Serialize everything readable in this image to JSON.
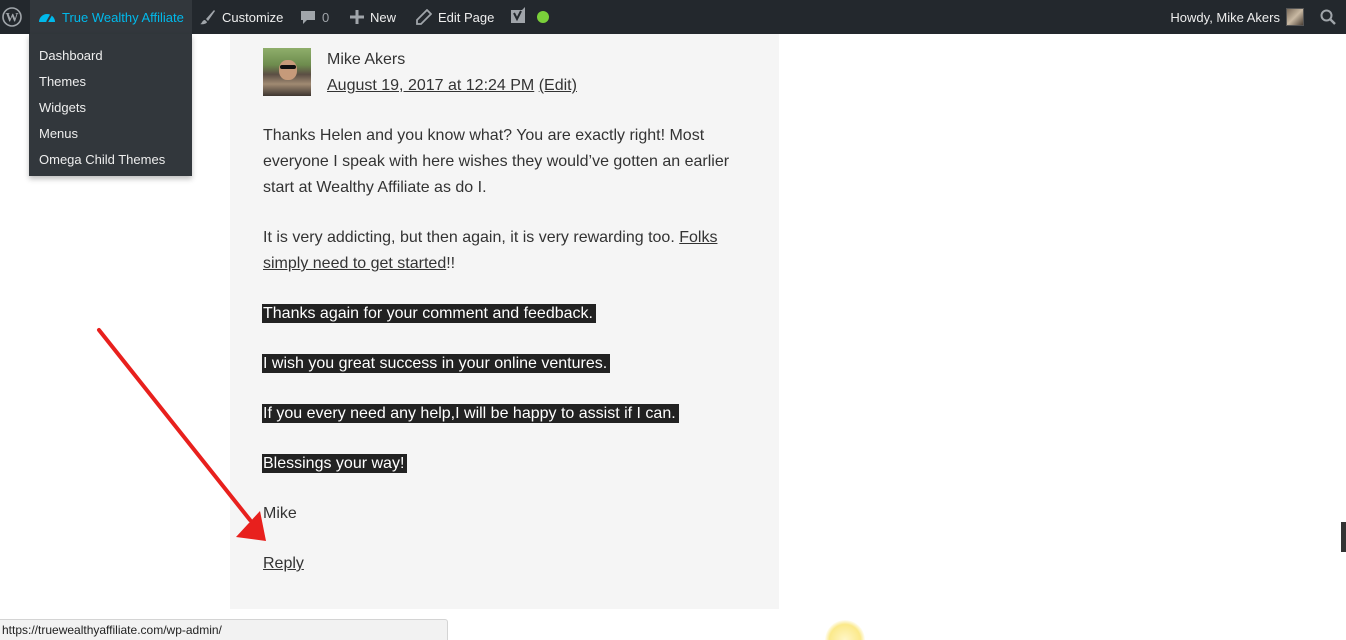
{
  "adminbar": {
    "site_name": "True Wealthy Affiliate",
    "customize": "Customize",
    "comments_count": "0",
    "new": "New",
    "edit_page": "Edit Page",
    "howdy": "Howdy, Mike Akers",
    "yoast_status_color": "#7ad03a",
    "accent_color": "#00b9eb"
  },
  "dropdown": {
    "items": [
      "Dashboard",
      "Themes",
      "Widgets",
      "Menus",
      "Omega Child Themes"
    ]
  },
  "comment": {
    "author": "Mike Akers",
    "date": "August 19, 2017 at 12:24 PM",
    "edit": "(Edit)",
    "para1": "Thanks Helen and you know what? You are exactly right! Most everyone I speak with here wishes they would’ve gotten an earlier start at Wealthy Affiliate as do I.",
    "para2_text": "It is very addicting, but then again, it is very rewarding too. ",
    "para2_link": "Folks simply need to get started",
    "para2_end": "!!",
    "highlights": [
      "Thanks again for your comment and feedback.",
      "I wish you great success in your online ventures.",
      "If you every need any help,I will be happy to assist if I can.",
      "Blessings your way!"
    ],
    "signature": "Mike",
    "reply": "Reply"
  },
  "statusbar": {
    "url": "https://truewealthyaffiliate.com/wp-admin/"
  }
}
